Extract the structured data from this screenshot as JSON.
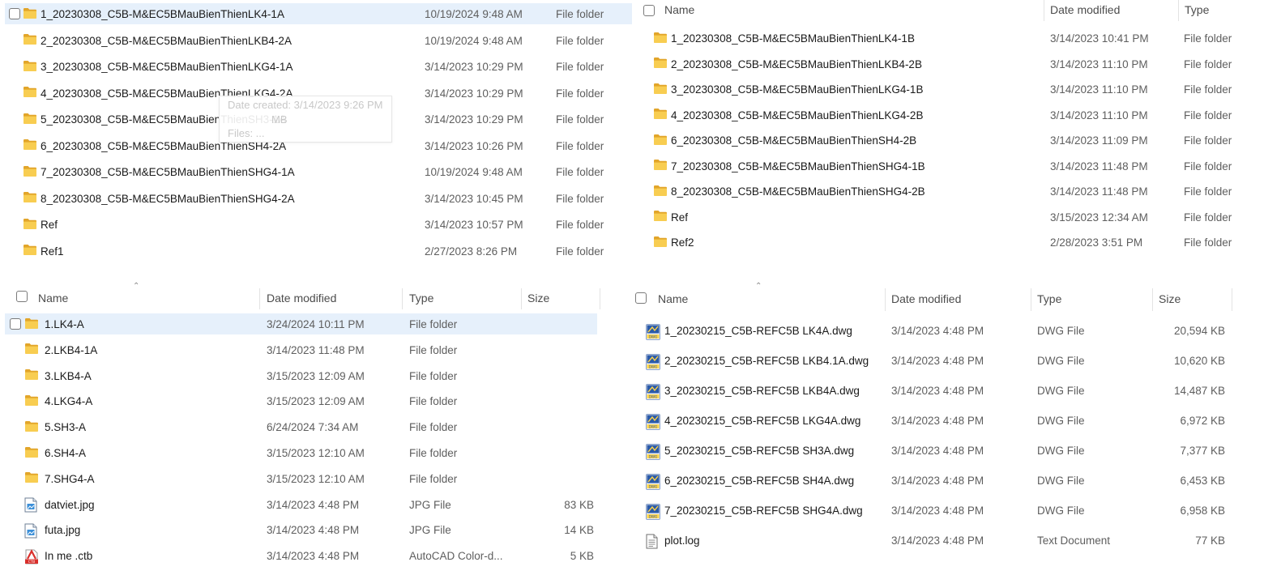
{
  "colors": {
    "folder": "#f4c142",
    "selection": "#e6f0fb",
    "dwg_blue": "#2b5aa8"
  },
  "icons": {
    "folder": "folder-icon",
    "dwg": "dwg-file-icon",
    "jpg": "image-file-icon",
    "ctb": "autocad-ctb-icon",
    "log": "text-file-icon"
  },
  "panel_tl": {
    "rows": [
      {
        "name": "1_20230308_C5B-M&EC5BMauBienThienLK4-1A",
        "date": "10/19/2024 9:48 AM",
        "type": "File folder"
      },
      {
        "name": "2_20230308_C5B-M&EC5BMauBienThienLKB4-2A",
        "date": "10/19/2024 9:48 AM",
        "type": "File folder"
      },
      {
        "name": "3_20230308_C5B-M&EC5BMauBienThienLKG4-1A",
        "date": "3/14/2023 10:29 PM",
        "type": "File folder"
      },
      {
        "name": "4_20230308_C5B-M&EC5BMauBienThienLKG4-2A",
        "date": "3/14/2023 10:29 PM",
        "type": "File folder"
      },
      {
        "name": "5_20230308_C5B-M&EC5BMauBienThienSH3-1A",
        "date": "3/14/2023 10:29 PM",
        "type": "File folder"
      },
      {
        "name": "6_20230308_C5B-M&EC5BMauBienThienSH4-2A",
        "date": "3/14/2023 10:26 PM",
        "type": "File folder"
      },
      {
        "name": "7_20230308_C5B-M&EC5BMauBienThienSHG4-1A",
        "date": "10/19/2024 9:48 AM",
        "type": "File folder"
      },
      {
        "name": "8_20230308_C5B-M&EC5BMauBienThienSHG4-2A",
        "date": "3/14/2023 10:45 PM",
        "type": "File folder"
      },
      {
        "name": "Ref",
        "date": "3/14/2023 10:57 PM",
        "type": "File folder"
      },
      {
        "name": "Ref1",
        "date": "2/27/2023 8:26 PM",
        "type": "File folder"
      }
    ],
    "tooltip": {
      "line1": "Date created: 3/14/2023 9:26 PM",
      "line2": "MB",
      "line3": "Files: ..."
    }
  },
  "panel_tr": {
    "headers": {
      "name": "Name",
      "date": "Date modified",
      "type": "Type"
    },
    "rows": [
      {
        "name": "1_20230308_C5B-M&EC5BMauBienThienLK4-1B",
        "date": "3/14/2023 10:41 PM",
        "type": "File folder"
      },
      {
        "name": "2_20230308_C5B-M&EC5BMauBienThienLKB4-2B",
        "date": "3/14/2023 11:10 PM",
        "type": "File folder"
      },
      {
        "name": "3_20230308_C5B-M&EC5BMauBienThienLKG4-1B",
        "date": "3/14/2023 11:10 PM",
        "type": "File folder"
      },
      {
        "name": "4_20230308_C5B-M&EC5BMauBienThienLKG4-2B",
        "date": "3/14/2023 11:10 PM",
        "type": "File folder"
      },
      {
        "name": "6_20230308_C5B-M&EC5BMauBienThienSH4-2B",
        "date": "3/14/2023 11:09 PM",
        "type": "File folder"
      },
      {
        "name": "7_20230308_C5B-M&EC5BMauBienThienSHG4-1B",
        "date": "3/14/2023 11:48 PM",
        "type": "File folder"
      },
      {
        "name": "8_20230308_C5B-M&EC5BMauBienThienSHG4-2B",
        "date": "3/14/2023 11:48 PM",
        "type": "File folder"
      },
      {
        "name": "Ref",
        "date": "3/15/2023 12:34 AM",
        "type": "File folder"
      },
      {
        "name": "Ref2",
        "date": "2/28/2023 3:51 PM",
        "type": "File folder"
      }
    ]
  },
  "panel_bl": {
    "headers": {
      "name": "Name",
      "date": "Date modified",
      "type": "Type",
      "size": "Size"
    },
    "rows": [
      {
        "icon": "folder",
        "name": "1.LK4-A",
        "date": "3/24/2024 10:11 PM",
        "type": "File folder",
        "size": ""
      },
      {
        "icon": "folder",
        "name": "2.LKB4-1A",
        "date": "3/14/2023 11:48 PM",
        "type": "File folder",
        "size": ""
      },
      {
        "icon": "folder",
        "name": "3.LKB4-A",
        "date": "3/15/2023 12:09 AM",
        "type": "File folder",
        "size": ""
      },
      {
        "icon": "folder",
        "name": "4.LKG4-A",
        "date": "3/15/2023 12:09 AM",
        "type": "File folder",
        "size": ""
      },
      {
        "icon": "folder",
        "name": "5.SH3-A",
        "date": "6/24/2024 7:34 AM",
        "type": "File folder",
        "size": ""
      },
      {
        "icon": "folder",
        "name": "6.SH4-A",
        "date": "3/15/2023 12:10 AM",
        "type": "File folder",
        "size": ""
      },
      {
        "icon": "folder",
        "name": "7.SHG4-A",
        "date": "3/15/2023 12:10 AM",
        "type": "File folder",
        "size": ""
      },
      {
        "icon": "jpg",
        "name": "datviet.jpg",
        "date": "3/14/2023 4:48 PM",
        "type": "JPG File",
        "size": "83 KB"
      },
      {
        "icon": "jpg",
        "name": "futa.jpg",
        "date": "3/14/2023 4:48 PM",
        "type": "JPG File",
        "size": "14 KB"
      },
      {
        "icon": "ctb",
        "name": "In me .ctb",
        "date": "3/14/2023 4:48 PM",
        "type": "AutoCAD Color-d...",
        "size": "5 KB"
      }
    ]
  },
  "panel_br": {
    "headers": {
      "name": "Name",
      "date": "Date modified",
      "type": "Type",
      "size": "Size"
    },
    "rows": [
      {
        "icon": "dwg",
        "name": "1_20230215_C5B-REFC5B LK4A.dwg",
        "date": "3/14/2023 4:48 PM",
        "type": "DWG File",
        "size": "20,594 KB"
      },
      {
        "icon": "dwg",
        "name": "2_20230215_C5B-REFC5B LKB4.1A.dwg",
        "date": "3/14/2023 4:48 PM",
        "type": "DWG File",
        "size": "10,620 KB"
      },
      {
        "icon": "dwg",
        "name": "3_20230215_C5B-REFC5B LKB4A.dwg",
        "date": "3/14/2023 4:48 PM",
        "type": "DWG File",
        "size": "14,487 KB"
      },
      {
        "icon": "dwg",
        "name": "4_20230215_C5B-REFC5B LKG4A.dwg",
        "date": "3/14/2023 4:48 PM",
        "type": "DWG File",
        "size": "6,972 KB"
      },
      {
        "icon": "dwg",
        "name": "5_20230215_C5B-REFC5B SH3A.dwg",
        "date": "3/14/2023 4:48 PM",
        "type": "DWG File",
        "size": "7,377 KB"
      },
      {
        "icon": "dwg",
        "name": "6_20230215_C5B-REFC5B SH4A.dwg",
        "date": "3/14/2023 4:48 PM",
        "type": "DWG File",
        "size": "6,453 KB"
      },
      {
        "icon": "dwg",
        "name": "7_20230215_C5B-REFC5B SHG4A.dwg",
        "date": "3/14/2023 4:48 PM",
        "type": "DWG File",
        "size": "6,958 KB"
      },
      {
        "icon": "log",
        "name": "plot.log",
        "date": "3/14/2023 4:48 PM",
        "type": "Text Document",
        "size": "77 KB"
      }
    ]
  }
}
